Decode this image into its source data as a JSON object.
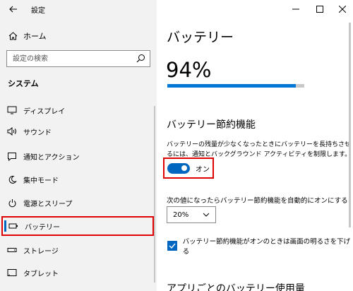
{
  "window": {
    "title": "設定"
  },
  "sidebar": {
    "home_label": "ホーム",
    "search_placeholder": "設定の検索",
    "section_title": "システム",
    "items": [
      {
        "label": "ディスプレイ",
        "icon": "monitor-icon"
      },
      {
        "label": "サウンド",
        "icon": "speaker-icon"
      },
      {
        "label": "通知とアクション",
        "icon": "notification-icon"
      },
      {
        "label": "集中モード",
        "icon": "moon-icon"
      },
      {
        "label": "電源とスリープ",
        "icon": "power-icon"
      },
      {
        "label": "バッテリー",
        "icon": "battery-icon",
        "selected": true
      },
      {
        "label": "ストレージ",
        "icon": "storage-icon"
      },
      {
        "label": "タブレット",
        "icon": "tablet-icon"
      }
    ]
  },
  "main": {
    "page_title": "バッテリー",
    "battery_percent": "94%",
    "battery_level": 0.94,
    "saver_heading": "バッテリー節約機能",
    "saver_description": "バッテリーの残量が少なくなったときにバッテリーを長持ちさせるには、通知とバックグラウンド アクティビティを制限します。",
    "toggle_state": "オン",
    "auto_label": "次の値になったらバッテリー節約機能を自動的にオンにする",
    "auto_value": "20%",
    "checkbox_label": "バッテリー節約機能がオンのときは画面の明るさを下げる",
    "checkbox_checked": true,
    "bottom_heading": "アプリごとのバッテリー使用量"
  },
  "colors": {
    "accent": "#0067c0",
    "highlight": "#e00000",
    "sidebar_bg": "#f2f2f2"
  }
}
